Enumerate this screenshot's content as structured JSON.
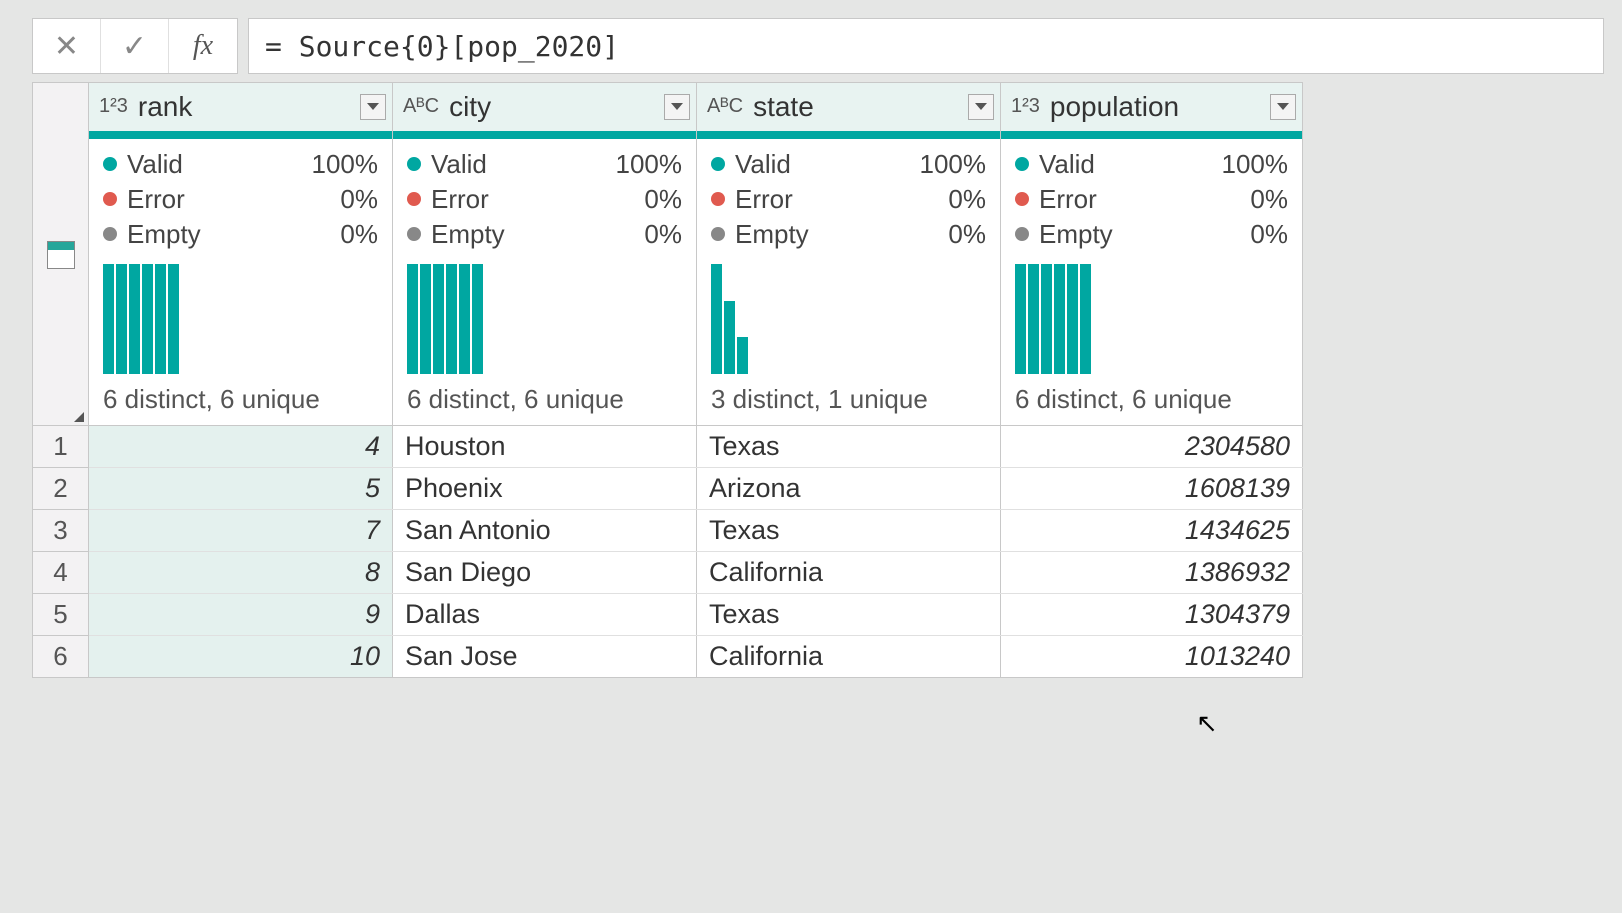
{
  "formula_bar": {
    "cancel_glyph": "✕",
    "commit_glyph": "✓",
    "fx_label": "fx",
    "formula": "= Source{0}[pop_2020]"
  },
  "columns": [
    {
      "name": "rank",
      "type": "number",
      "quality": {
        "valid_label": "Valid",
        "valid_pct": "100%",
        "error_label": "Error",
        "error_pct": "0%",
        "empty_label": "Empty",
        "empty_pct": "0%"
      },
      "bars": [
        100,
        100,
        100,
        100,
        100,
        100
      ],
      "distinct_text": "6 distinct, 6 unique"
    },
    {
      "name": "city",
      "type": "text",
      "quality": {
        "valid_label": "Valid",
        "valid_pct": "100%",
        "error_label": "Error",
        "error_pct": "0%",
        "empty_label": "Empty",
        "empty_pct": "0%"
      },
      "bars": [
        100,
        100,
        100,
        100,
        100,
        100
      ],
      "distinct_text": "6 distinct, 6 unique"
    },
    {
      "name": "state",
      "type": "text",
      "quality": {
        "valid_label": "Valid",
        "valid_pct": "100%",
        "error_label": "Error",
        "error_pct": "0%",
        "empty_label": "Empty",
        "empty_pct": "0%"
      },
      "bars": [
        100,
        66,
        33
      ],
      "distinct_text": "3 distinct, 1 unique"
    },
    {
      "name": "population",
      "type": "number",
      "quality": {
        "valid_label": "Valid",
        "valid_pct": "100%",
        "error_label": "Error",
        "error_pct": "0%",
        "empty_label": "Empty",
        "empty_pct": "0%"
      },
      "bars": [
        100,
        100,
        100,
        100,
        100,
        100
      ],
      "distinct_text": "6 distinct, 6 unique"
    }
  ],
  "rows": [
    {
      "rank": "4",
      "city": "Houston",
      "state": "Texas",
      "population": "2304580"
    },
    {
      "rank": "5",
      "city": "Phoenix",
      "state": "Arizona",
      "population": "1608139"
    },
    {
      "rank": "7",
      "city": "San Antonio",
      "state": "Texas",
      "population": "1434625"
    },
    {
      "rank": "8",
      "city": "San Diego",
      "state": "California",
      "population": "1386932"
    },
    {
      "rank": "9",
      "city": "Dallas",
      "state": "Texas",
      "population": "1304379"
    },
    {
      "rank": "10",
      "city": "San Jose",
      "state": "California",
      "population": "1013240"
    }
  ],
  "row_numbers": [
    "1",
    "2",
    "3",
    "4",
    "5",
    "6"
  ],
  "chart_data": {
    "type": "table",
    "columns": [
      "rank",
      "city",
      "state",
      "population"
    ],
    "rows": [
      [
        4,
        "Houston",
        "Texas",
        2304580
      ],
      [
        5,
        "Phoenix",
        "Arizona",
        1608139
      ],
      [
        7,
        "San Antonio",
        "Texas",
        1434625
      ],
      [
        8,
        "San Diego",
        "California",
        1386932
      ],
      [
        9,
        "Dallas",
        "Texas",
        1304379
      ],
      [
        10,
        "San Jose",
        "California",
        1013240
      ]
    ]
  }
}
